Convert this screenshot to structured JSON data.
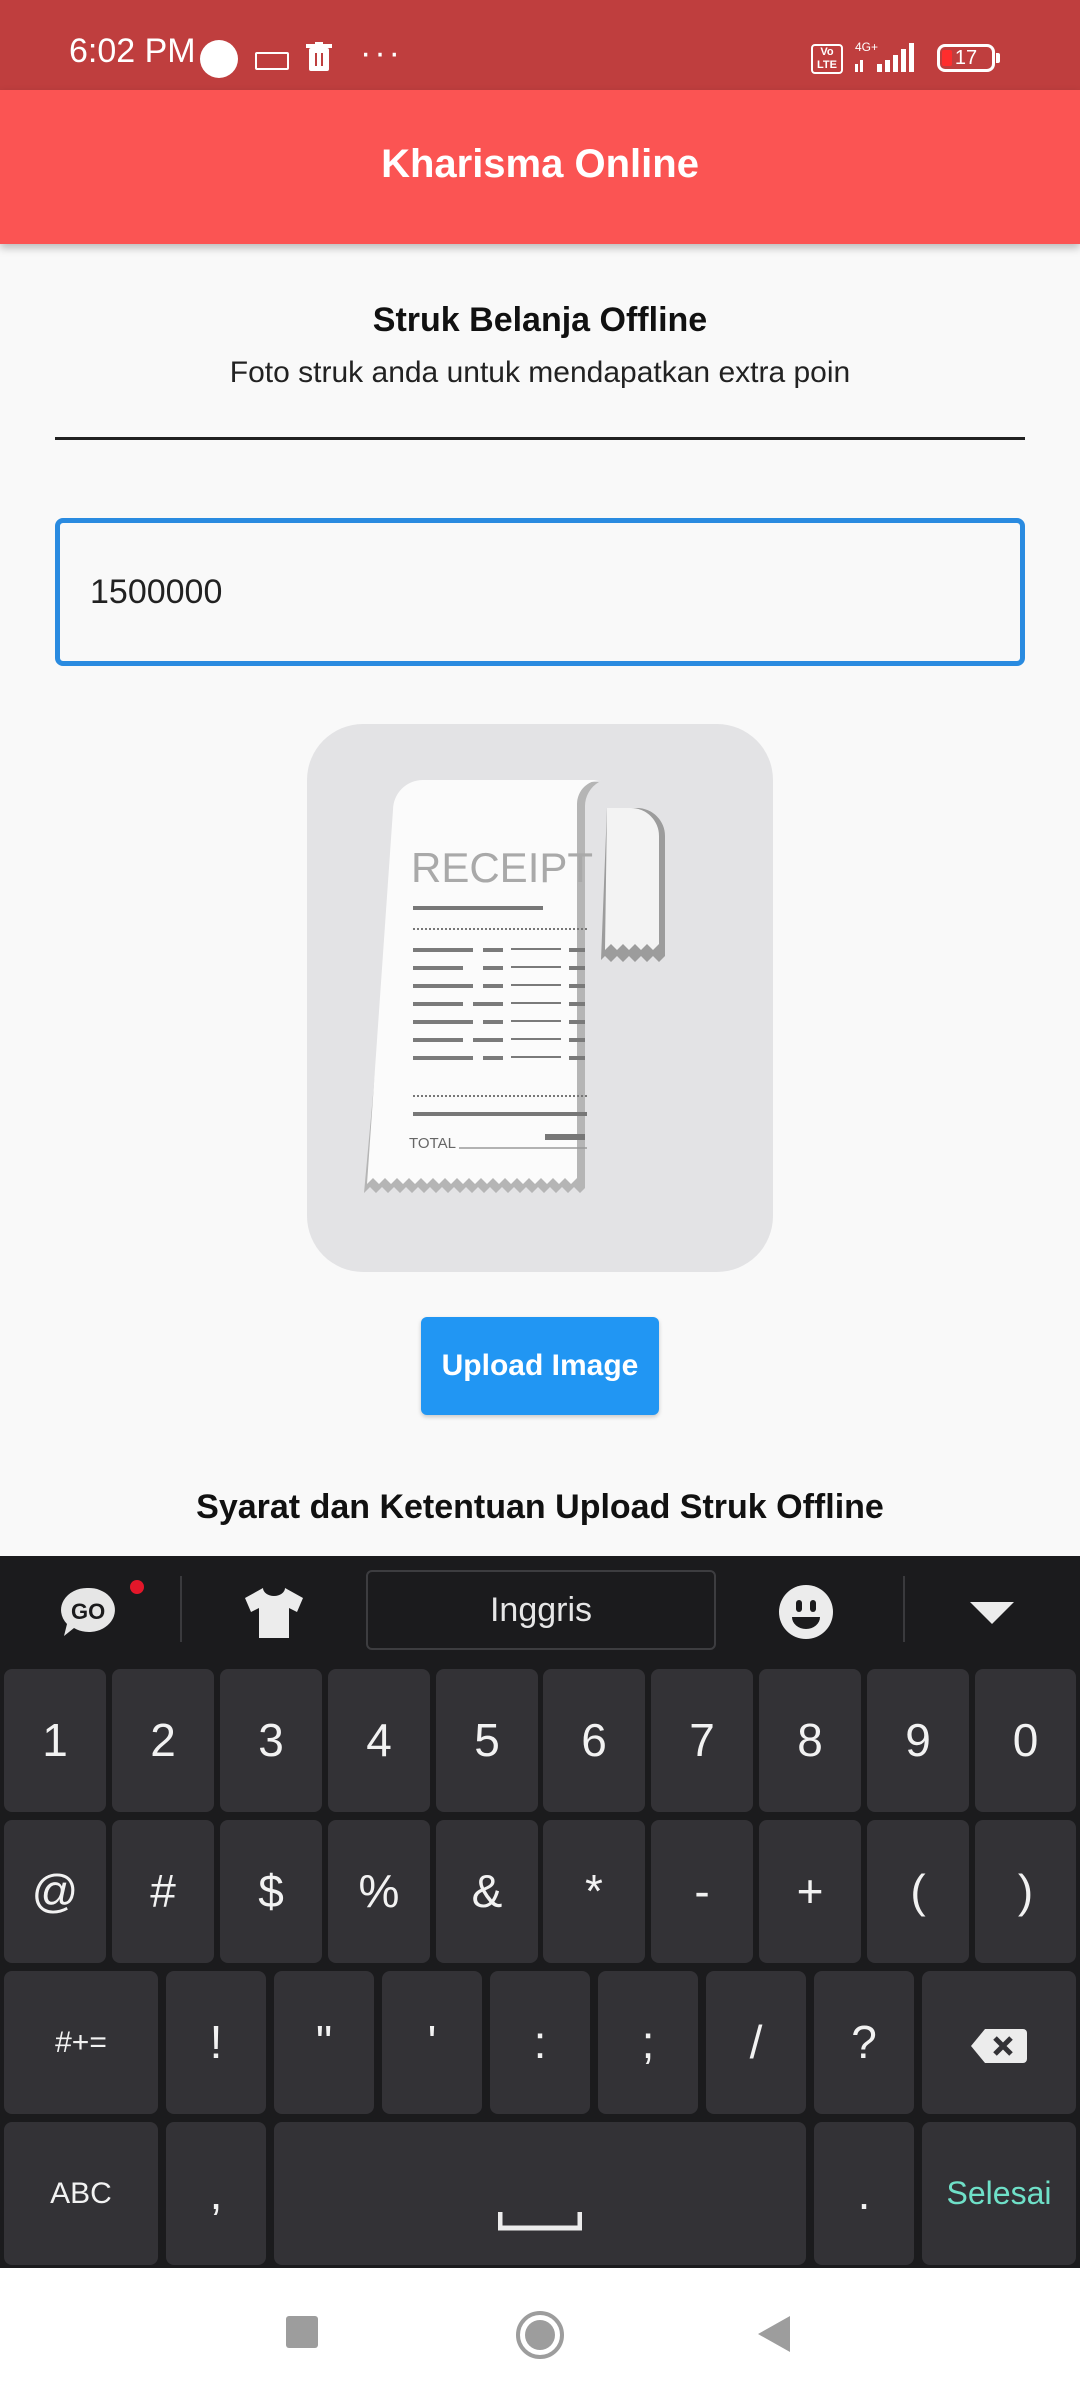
{
  "status_bar": {
    "time": "6:02 PM",
    "network": "4G+",
    "volte": "Vo LTE",
    "battery": "17",
    "more": "···"
  },
  "app_bar": {
    "title": "Kharisma Online"
  },
  "content": {
    "heading": "Struk Belanja Offline",
    "subheading": "Foto struk anda untuk mendapatkan extra poin",
    "amount_value": "1500000",
    "receipt_image": {
      "title": "RECEIPT",
      "total_label": "TOTAL"
    },
    "upload_button_label": "Upload Image",
    "terms_title": "Syarat dan Ketentuan Upload Struk Offline"
  },
  "keyboard": {
    "language": "Inggris",
    "go_label": "GO",
    "row1": [
      "1",
      "2",
      "3",
      "4",
      "5",
      "6",
      "7",
      "8",
      "9",
      "0"
    ],
    "row2": [
      "@",
      "#",
      "$",
      "%",
      "&",
      "*",
      "-",
      "+",
      "(",
      ")"
    ],
    "row3": [
      "#+=",
      "!",
      "\"",
      "'",
      ":",
      ";",
      "/",
      "?"
    ],
    "row4": {
      "abc": "ABC",
      "comma": ",",
      "period": ".",
      "done": "Selesai"
    }
  },
  "colors": {
    "status_bar": "#bf3e3e",
    "app_bar": "#fb5453",
    "accent_blue": "#2196f3",
    "field_border": "#2a8be0",
    "keyboard_bg": "#1b1b1d",
    "key_bg": "#333236",
    "done_text": "#6fe0c8"
  }
}
